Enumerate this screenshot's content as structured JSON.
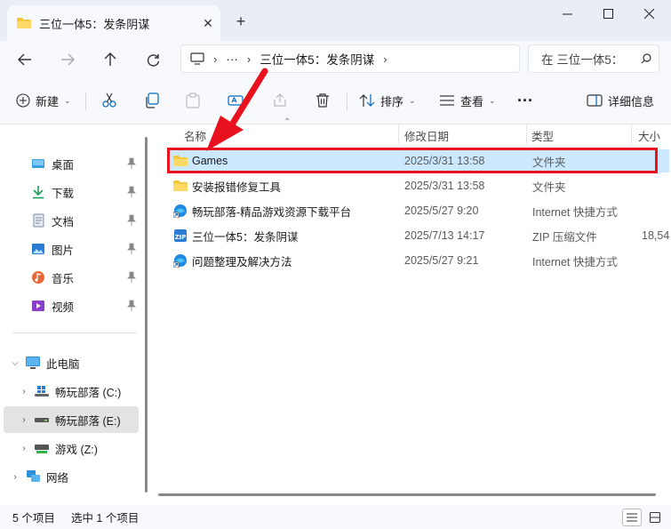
{
  "window": {
    "tab_title": "三位一体5：发条阴谋",
    "tab_close": "✕",
    "new_tab": "+"
  },
  "address": {
    "ellipsis": "···",
    "path_segment": "三位一体5：发条阴谋"
  },
  "search": {
    "placeholder": "在 三位一体5："
  },
  "toolbar": {
    "new_label": "新建",
    "sort_label": "排序",
    "view_label": "查看",
    "more": "···",
    "details_label": "详细信息"
  },
  "sidebar": {
    "quick_access": [
      {
        "label": "桌面"
      },
      {
        "label": "下载"
      },
      {
        "label": "文档"
      },
      {
        "label": "图片"
      },
      {
        "label": "音乐"
      },
      {
        "label": "视频"
      }
    ],
    "this_pc": "此电脑",
    "drives": [
      {
        "label": "畅玩部落 (C:)"
      },
      {
        "label": "畅玩部落 (E:)"
      },
      {
        "label": "游戏 (Z:)"
      }
    ],
    "network": "网络"
  },
  "columns": {
    "name": "名称",
    "modified": "修改日期",
    "type": "类型",
    "size": "大小"
  },
  "files": [
    {
      "name": "Games",
      "modified": "2025/3/31 13:58",
      "type": "文件夹",
      "size": "",
      "icon": "folder-icon"
    },
    {
      "name": "安装报错修复工具",
      "modified": "2025/3/31 13:58",
      "type": "文件夹",
      "size": "",
      "icon": "folder-icon"
    },
    {
      "name": "畅玩部落-精品游戏资源下载平台",
      "modified": "2025/5/27 9:20",
      "type": "Internet 快捷方式",
      "size": "",
      "icon": "internet-shortcut-icon"
    },
    {
      "name": "三位一体5：发条阴谋",
      "modified": "2025/7/13 14:17",
      "type": "ZIP 压缩文件",
      "size": "18,54",
      "icon": "zip-icon"
    },
    {
      "name": "问题整理及解决方法",
      "modified": "2025/5/27 9:21",
      "type": "Internet 快捷方式",
      "size": "",
      "icon": "internet-shortcut-icon"
    }
  ],
  "status": {
    "item_count": "5 个项目",
    "selected_count": "选中 1 个项目"
  },
  "colors": {
    "selection": "#cce8ff",
    "highlight_box": "#e8121e",
    "accent": "#0067c0"
  }
}
